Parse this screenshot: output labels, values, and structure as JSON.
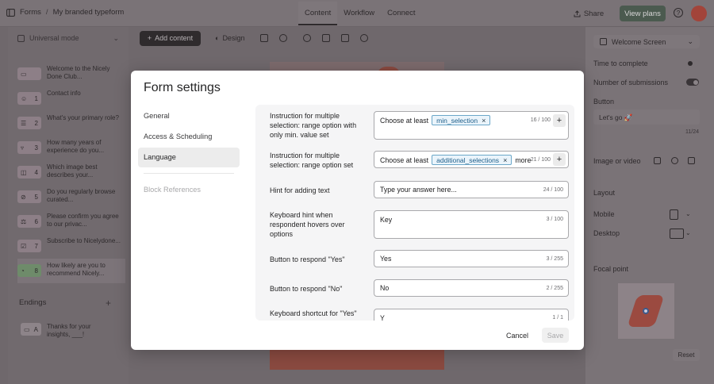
{
  "topbar": {
    "breadcrumb_root": "Forms",
    "breadcrumb_separator": "/",
    "form_name": "My branded typeform",
    "tabs": [
      {
        "label": "Content"
      },
      {
        "label": "Workflow"
      },
      {
        "label": "Connect"
      }
    ],
    "share_label": "Share",
    "view_plans_label": "View plans"
  },
  "left_panel": {
    "mode_label": "Universal mode",
    "questions": [
      {
        "number": "",
        "text": "Welcome to the Nicely Done Club..."
      },
      {
        "number": "1",
        "text": "Contact info"
      },
      {
        "number": "2",
        "text": "What's your primary role?"
      },
      {
        "number": "3",
        "text": "How many years of experience do you..."
      },
      {
        "number": "4",
        "text": "Which image best describes your..."
      },
      {
        "number": "5",
        "text": "Do you regularly browse curated..."
      },
      {
        "number": "6",
        "text": "Please confirm you agree to our privac..."
      },
      {
        "number": "7",
        "text": "Subscribe to Nicelydone..."
      },
      {
        "number": "8",
        "text": "How likely are you to recommend Nicely..."
      }
    ],
    "endings_title": "Endings",
    "ending": {
      "letter": "A",
      "text": "Thanks for your insights, ___!"
    }
  },
  "toolbar": {
    "add_content_label": "Add content",
    "design_label": "Design"
  },
  "right_panel": {
    "screen_select": "Welcome Screen",
    "time_to_complete": "Time to complete",
    "number_of_submissions": "Number of submissions",
    "button_label": "Button",
    "button_value": "Let's go 🚀",
    "button_count": "11/24",
    "image_or_video": "Image or video",
    "layout_title": "Layout",
    "mobile_label": "Mobile",
    "desktop_label": "Desktop",
    "focal_point_title": "Focal point",
    "reset_label": "Reset"
  },
  "modal": {
    "title": "Form settings",
    "nav": [
      {
        "label": "General",
        "active": false
      },
      {
        "label": "Access & Scheduling",
        "active": false
      },
      {
        "label": "Language",
        "active": true
      }
    ],
    "nav_disabled": "Block References",
    "settings": [
      {
        "label": "Instruction for multiple selection: range option with only min. value set",
        "prefix": "Choose at least",
        "chip": "min_selection",
        "suffix": "",
        "count": "16 / 100"
      },
      {
        "label": "Instruction for multiple selection: range option set",
        "prefix": "Choose at least",
        "chip": "additional_selections",
        "suffix": "more",
        "count": "21 / 100"
      },
      {
        "label": "Hint for adding text",
        "value": "Type your answer here...",
        "count": "24 / 100"
      },
      {
        "label": "Keyboard hint when respondent hovers over options",
        "value": "Key",
        "count": "3 / 100"
      },
      {
        "label": "Button to respond \"Yes\"",
        "value": "Yes",
        "count": "3 / 255"
      },
      {
        "label": "Button to respond \"No\"",
        "value": "No",
        "count": "2 / 255"
      },
      {
        "label": "Keyboard shortcut for \"Yes\"",
        "value": "Y",
        "count": "1 / 1"
      }
    ],
    "cancel_label": "Cancel",
    "save_label": "Save"
  }
}
